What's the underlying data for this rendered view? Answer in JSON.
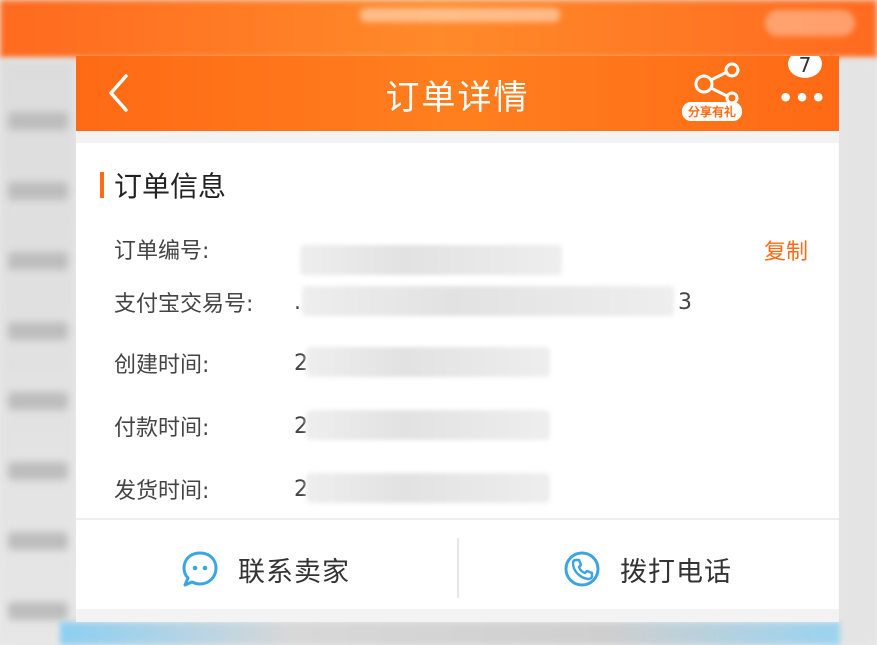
{
  "header": {
    "title": "订单详情",
    "share_badge": "分享有礼",
    "message_count": "7",
    "more_label": "•••"
  },
  "order_info": {
    "section_title": "订单信息",
    "copy_label": "复制",
    "rows": [
      {
        "label": "订单编号:",
        "value_prefix": "",
        "value_suffix": ""
      },
      {
        "label": "支付宝交易号:",
        "value_prefix": ".",
        "value_suffix": "3"
      },
      {
        "label": "创建时间:",
        "value_prefix": "2",
        "value_suffix": ""
      },
      {
        "label": "付款时间:",
        "value_prefix": "2",
        "value_suffix": ""
      },
      {
        "label": "发货时间:",
        "value_prefix": "2",
        "value_suffix": ""
      }
    ]
  },
  "footer": {
    "contact_seller": "联系卖家",
    "call_phone": "拨打电话"
  },
  "colors": {
    "accent": "#ff6a14",
    "icon_blue": "#3aa5e0"
  }
}
